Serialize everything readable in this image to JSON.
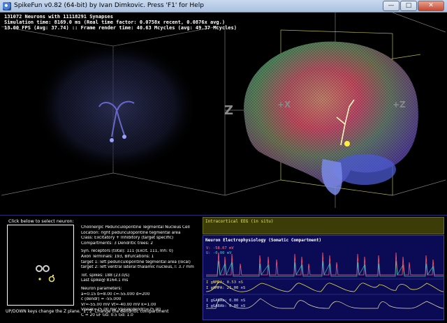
{
  "window": {
    "title": "SpikeFun v0.82 (64-bit) by Ivan Dimkovic. Press 'F1' for Help",
    "minimize_glyph": "—",
    "maximize_glyph": "□",
    "close_glyph": "✕"
  },
  "hud": {
    "line1": "131072 Neurons with 11118291 Synapses",
    "line2": "Simulation time: 8169.0 ms (Real time factor: 0.0758x recent, 0.0876x avg.)",
    "line3": "13.00 FPS (Avg: 37.74) :: Frame render time: 40.63 Mcycles (avg: 49.37 Mcycles)"
  },
  "axes": {
    "z": "Z",
    "x": "+X",
    "z_right": "+Z"
  },
  "selector": {
    "label": "Click below to select neuron:",
    "help": "UP/DOWN keys change the Z plane. '1','2' Change the dendritic compartment"
  },
  "neuron_info": {
    "name": "Cholinergic Pedunculopontine Tegmental Nucleus Cell",
    "location": "Location: right pedunculopontine tegmental area",
    "class": "Class: Excitatory + Inhibitory (target specific)",
    "compartments": "Compartments: 3  Dendritic trees: 2",
    "syn": "Syn. receptors (total): 111 (Excit. 111, Inh: 0)",
    "axon": "Axon Terminals: 193, Bifurcations: 1",
    "target1": "  target 1: left pedunculopontine tegmental area (local)",
    "target2": "  target 2: left ventral lateral thalamic nucleus, l: 3.7 mm",
    "spikes": "Tot. spikes: 188 (23.0/s)",
    "last_spike": "Last spike@ 8164.1 ms",
    "params_title": "Neuron parameters:",
    "p1": "a=0.15  b=8.00 c=-55.000  d=200",
    "p2": "c (dendr) = -55.000",
    "p3": "Vr=-55.00 mV  Vt=-40.00 mV  k=1.00",
    "p4": "Vpeak=25.00 mV  Vpeak(dendr)=25.00",
    "p5": "C = 20 uF  Gu: 0.5  Gd: 1.0"
  },
  "eeg": {
    "label": "Intracortical EEG (in situ)"
  },
  "ephys": {
    "label": "Neuron Electrophysiology (Somatic Compartment)",
    "v": "V: -58.07 mV",
    "u": "U: -0.00 mV",
    "gnmda": "I gNMDA: 0.53 nS",
    "gampa": "I gAMPA: 21.00 nS",
    "ggabaa": "I gGABAa: 0.00 nS",
    "ggabab": "I gGABAb: 0.00 nS"
  },
  "colors": {
    "v_trace": "#ff5a6e",
    "u_trace": "#3fd0c0",
    "nmda_trace": "#e8e04a",
    "ampa_trace": "#e8e0b0",
    "eeg_bg": "#3c3c08",
    "ephys_bg": "#0b0b55"
  }
}
